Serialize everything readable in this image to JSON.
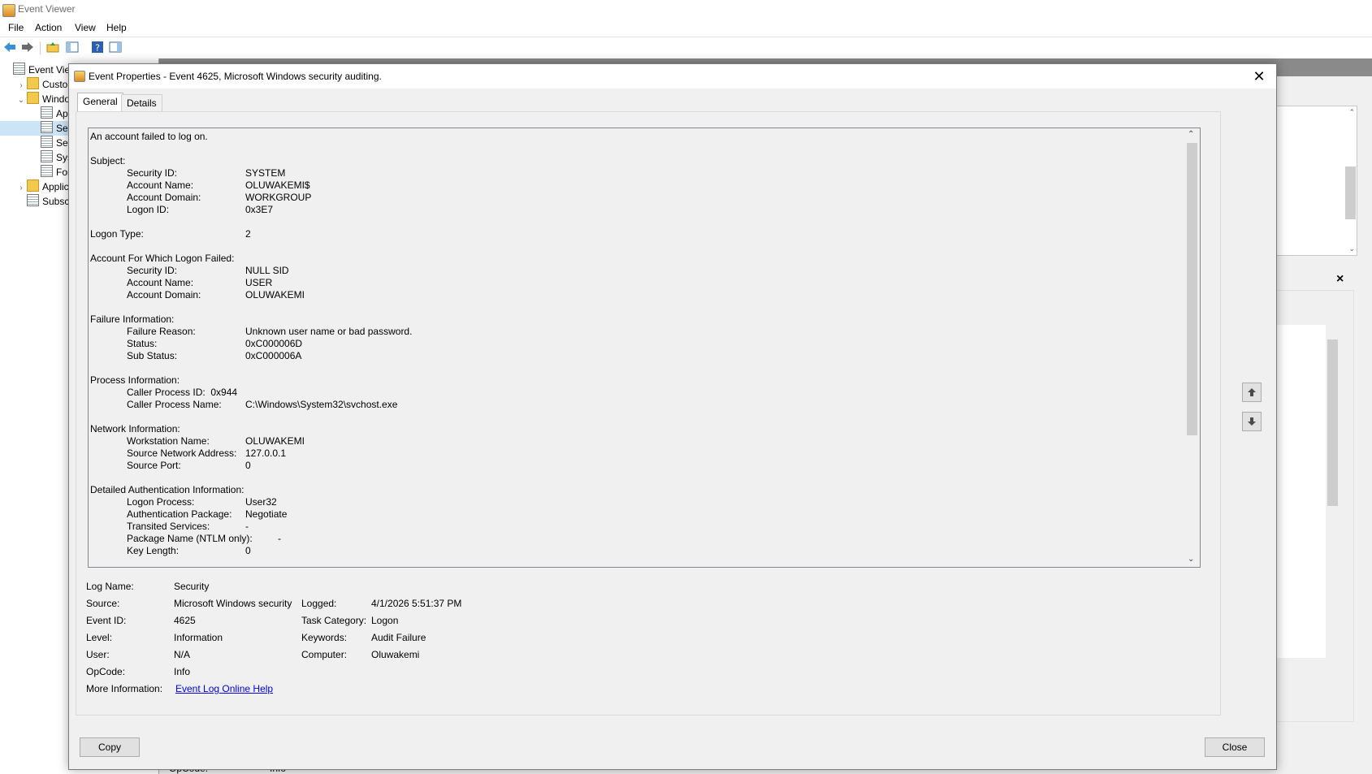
{
  "window": {
    "title": "Event Viewer"
  },
  "menu": [
    "File",
    "Action",
    "View",
    "Help"
  ],
  "toolbar": [
    "back-icon",
    "forward-icon",
    "up-folder-icon",
    "show-hide-tree-icon",
    "help-icon",
    "action-pane-icon"
  ],
  "tree": [
    {
      "label": "Event Viewe",
      "level": 0,
      "expander": "",
      "icon": "log"
    },
    {
      "label": "Custom",
      "level": 1,
      "expander": ">",
      "icon": "folder"
    },
    {
      "label": "Window",
      "level": 1,
      "expander": "v",
      "icon": "folder"
    },
    {
      "label": "App",
      "level": 2,
      "expander": "",
      "icon": "log"
    },
    {
      "label": "Secu",
      "level": 2,
      "expander": "",
      "icon": "log",
      "selected": true
    },
    {
      "label": "Setu",
      "level": 2,
      "expander": "",
      "icon": "log"
    },
    {
      "label": "Syst",
      "level": 2,
      "expander": "",
      "icon": "log"
    },
    {
      "label": "Forv",
      "level": 2,
      "expander": "",
      "icon": "log"
    },
    {
      "label": "Applica",
      "level": 1,
      "expander": ">",
      "icon": "folder"
    },
    {
      "label": "Subscrip",
      "level": 1,
      "expander": "",
      "icon": "log"
    }
  ],
  "background": {
    "opcode_label": "OpCode:",
    "opcode_value": "Info"
  },
  "dialog": {
    "title": "Event Properties - Event 4625, Microsoft Windows security auditing.",
    "tabs": [
      "General",
      "Details"
    ],
    "description": [
      {
        "label": "An account failed to log on.",
        "value": "",
        "indent": 0
      },
      {
        "label": "",
        "value": "",
        "indent": 0
      },
      {
        "label": "Subject:",
        "value": "",
        "indent": 0
      },
      {
        "label": "Security ID:",
        "value": "SYSTEM",
        "indent": 1
      },
      {
        "label": "Account Name:",
        "value": "OLUWAKEMI$",
        "indent": 1
      },
      {
        "label": "Account Domain:",
        "value": "WORKGROUP",
        "indent": 1
      },
      {
        "label": "Logon ID:",
        "value": "0x3E7",
        "indent": 1
      },
      {
        "label": "",
        "value": "",
        "indent": 0
      },
      {
        "label": "Logon Type:",
        "value": "2",
        "indent": 0
      },
      {
        "label": "",
        "value": "",
        "indent": 0
      },
      {
        "label": "Account For Which Logon Failed:",
        "value": "",
        "indent": 0
      },
      {
        "label": "Security ID:",
        "value": "NULL SID",
        "indent": 1
      },
      {
        "label": "Account Name:",
        "value": "USER",
        "indent": 1
      },
      {
        "label": "Account Domain:",
        "value": "OLUWAKEMI",
        "indent": 1
      },
      {
        "label": "",
        "value": "",
        "indent": 0
      },
      {
        "label": "Failure Information:",
        "value": "",
        "indent": 0
      },
      {
        "label": "Failure Reason:",
        "value": "Unknown user name or bad password.",
        "indent": 1
      },
      {
        "label": "Status:",
        "value": "0xC000006D",
        "indent": 1
      },
      {
        "label": "Sub Status:",
        "value": "0xC000006A",
        "indent": 1
      },
      {
        "label": "",
        "value": "",
        "indent": 0
      },
      {
        "label": "Process Information:",
        "value": "",
        "indent": 0
      },
      {
        "label": "Caller Process ID:  0x944",
        "value": "",
        "indent": 1
      },
      {
        "label": "Caller Process Name:",
        "value": "C:\\Windows\\System32\\svchost.exe",
        "indent": 1
      },
      {
        "label": "",
        "value": "",
        "indent": 0
      },
      {
        "label": "Network Information:",
        "value": "",
        "indent": 0
      },
      {
        "label": "Workstation Name:",
        "value": "OLUWAKEMI",
        "indent": 1
      },
      {
        "label": "Source Network Address:",
        "value": "127.0.0.1",
        "indent": 1
      },
      {
        "label": "Source Port:",
        "value": "0",
        "indent": 1
      },
      {
        "label": "",
        "value": "",
        "indent": 0
      },
      {
        "label": "Detailed Authentication Information:",
        "value": "",
        "indent": 0
      },
      {
        "label": "Logon Process:",
        "value": "User32",
        "indent": 1
      },
      {
        "label": "Authentication Package:",
        "value": "Negotiate",
        "indent": 1
      },
      {
        "label": "Transited Services:",
        "value": "-",
        "indent": 1
      },
      {
        "label": "Package Name (NTLM only):",
        "value": "            -",
        "indent": 1
      },
      {
        "label": "Key Length:",
        "value": "0",
        "indent": 1
      }
    ],
    "meta_left": [
      {
        "label": "Log Name:",
        "value": "Security"
      },
      {
        "label": "Source:",
        "value": "Microsoft Windows security"
      },
      {
        "label": "Event ID:",
        "value": "4625"
      },
      {
        "label": "Level:",
        "value": "Information"
      },
      {
        "label": "User:",
        "value": "N/A"
      },
      {
        "label": "OpCode:",
        "value": "Info"
      },
      {
        "label": "More Information:",
        "value": "Event Log Online Help"
      }
    ],
    "meta_right": [
      {
        "label": "Logged:",
        "value": "4/1/2026 5:51:37 PM"
      },
      {
        "label": "Task Category:",
        "value": "Logon"
      },
      {
        "label": "Keywords:",
        "value": "Audit Failure"
      },
      {
        "label": "Computer:",
        "value": "Oluwakemi"
      }
    ],
    "copy_label": "Copy",
    "close_label": "Close"
  }
}
